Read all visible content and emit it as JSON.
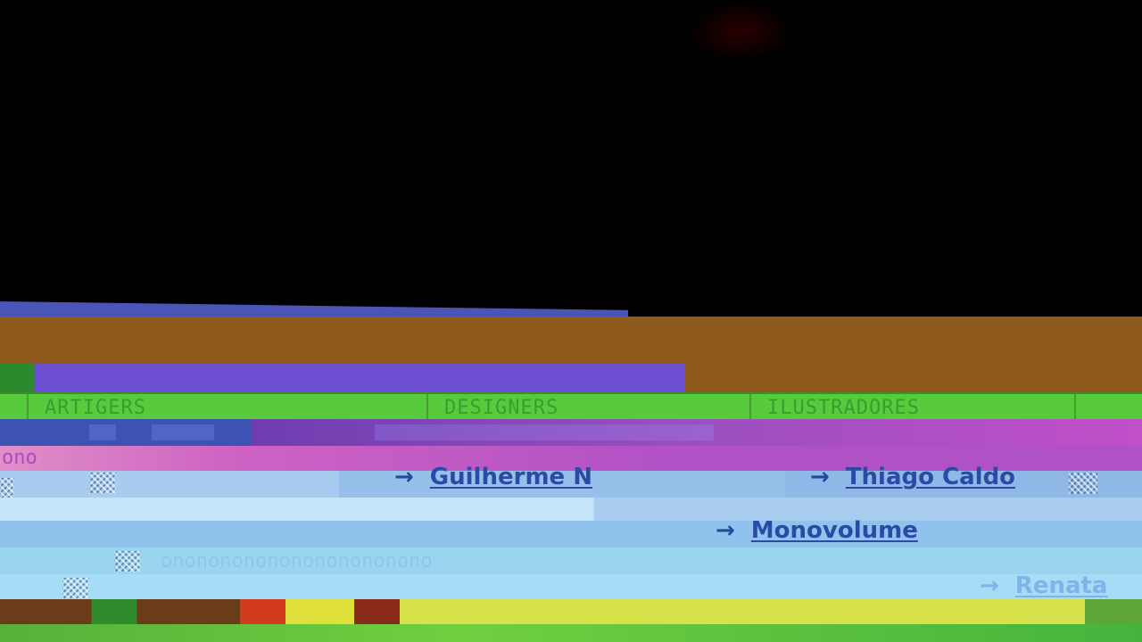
{
  "categories": {
    "col1": "ARTIGERS",
    "col2": "DESIGNERS",
    "col3": "ILUSTRADORES"
  },
  "magenta_text": "ono",
  "links": {
    "l1": "Guilherme N",
    "l2": "Thiago Caldo",
    "l3": "Monovolume",
    "l4": "Renata"
  },
  "arrow_glyph": "→",
  "cyan_dots": "ononononononononononono",
  "colors": {
    "background": "#000000",
    "link": "#2b4aa6",
    "green_band": "#57cb3b",
    "brown_band": "#8f5b1d"
  }
}
